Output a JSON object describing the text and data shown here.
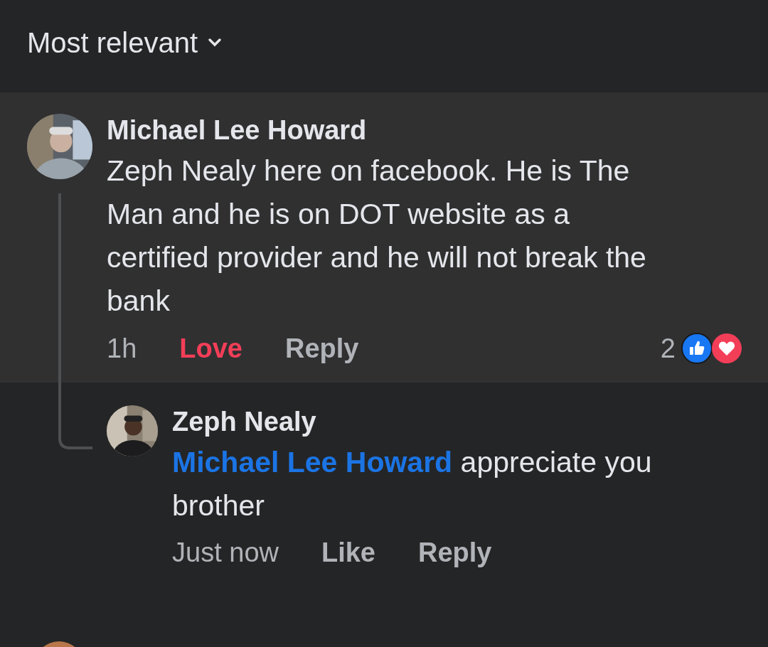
{
  "sort": {
    "label": "Most relevant"
  },
  "comments": [
    {
      "author": "Michael Lee Howard",
      "highlighted": true,
      "text": "Zeph Nealy here on facebook. He is The Man and he is on DOT website as a certified provider and he will not break the bank",
      "time": "1h",
      "actions": [
        {
          "label": "Love",
          "reacted": true
        },
        {
          "label": "Reply",
          "reacted": false
        }
      ],
      "reaction_count": "2",
      "replies": [
        {
          "author": "Zeph Nealy",
          "highlighted": false,
          "mention": "Michael Lee Howard",
          "text": "appreciate you brother",
          "time": "Just now",
          "actions": [
            {
              "label": "Like",
              "reacted": false
            },
            {
              "label": "Reply",
              "reacted": false
            }
          ]
        }
      ]
    }
  ]
}
